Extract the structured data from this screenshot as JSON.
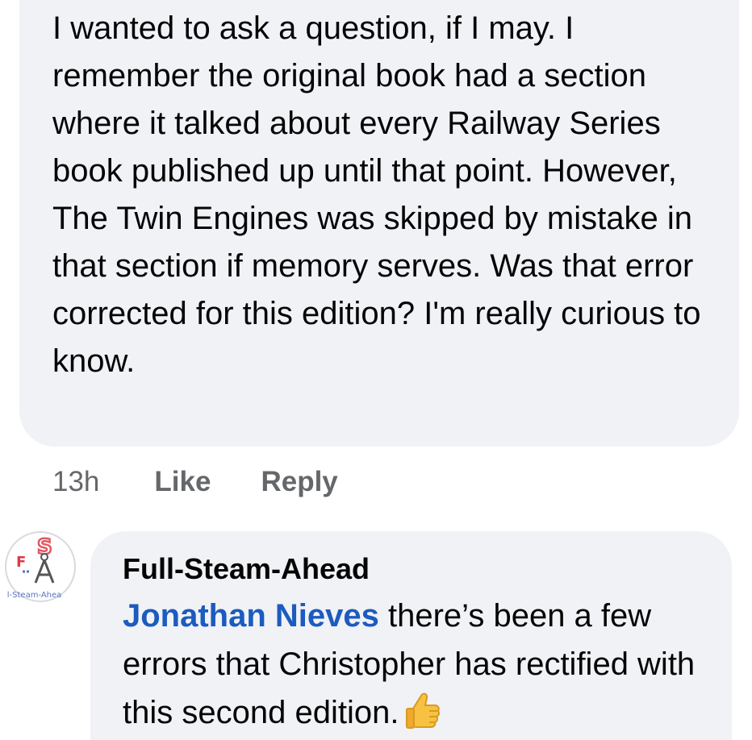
{
  "comment": {
    "text": "I wanted to ask a question, if I may. I remember the original book had a section where it talked about every Railway Series book published up until that point. However, The Twin Engines was skipped by mistake in that section if memory serves. Was that error corrected for this edition? I'm really curious to know.",
    "time": "13h",
    "like_label": "Like",
    "reply_label": "Reply"
  },
  "reply": {
    "author": "Full-Steam-Ahead",
    "mention": "Jonathan Nieves",
    "text": " there’s been a few errors that Christopher has rectified with this second edition.",
    "emoji": "thumbs-up-icon",
    "avatar_logo_text": "ll-Steam-Ahea"
  },
  "colors": {
    "bubble": "#f0f2f5",
    "mention": "#1c5bbf",
    "meta": "#65676b"
  }
}
